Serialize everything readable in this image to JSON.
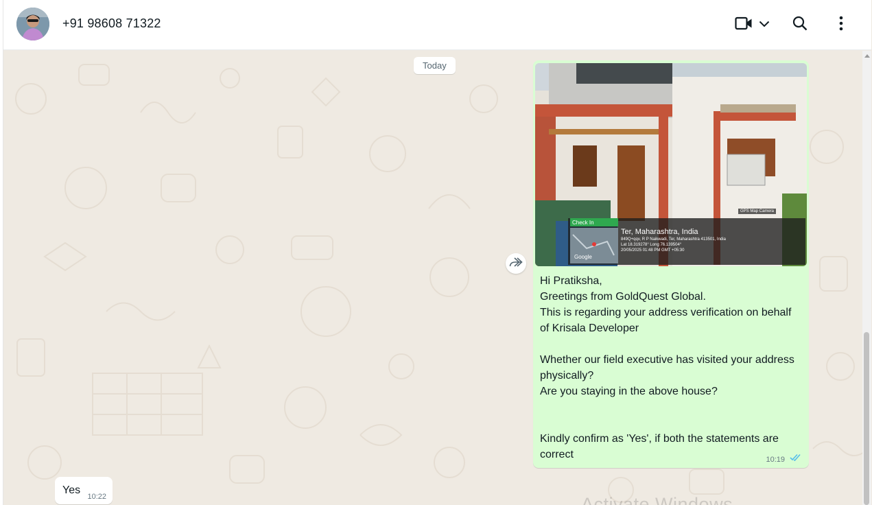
{
  "header": {
    "contact_name": "+91 98608 71322",
    "icons": [
      "avatar",
      "video-call-icon",
      "chevron-down-icon",
      "search-icon",
      "menu-dots-icon"
    ]
  },
  "chat": {
    "date_divider": "Today",
    "outgoing": {
      "photo_overlay": {
        "badge": "Check In",
        "place": "Ter, Maharashtra, India",
        "address": "849Q+qqv, R P Naikwadi, Ter, Maharashtra 413501, India",
        "coords": "Lat 18.319278° Long 76.139504°",
        "datetime": "20/05/2025 01:48 PM GMT +05:30",
        "camera_label": "GPS Map Camera",
        "map_label": "Google"
      },
      "text": "Hi Pratiksha,\nGreetings from GoldQuest Global.\nThis is regarding your address verification on behalf of Krisala Developer\n\nWhether our field executive has visited your address physically?\nAre you staying in the above house?\n\n\nKindly confirm as 'Yes', if both the statements are correct",
      "time": "10:19",
      "status": "read"
    },
    "incoming": {
      "text": "Yes",
      "time": "10:22"
    },
    "watermark": "Activate Windows"
  },
  "colors": {
    "outgoing_bubble": "#d9fdd3",
    "incoming_bubble": "#ffffff",
    "chat_background": "#efeae2",
    "read_ticks": "#53bdeb"
  }
}
